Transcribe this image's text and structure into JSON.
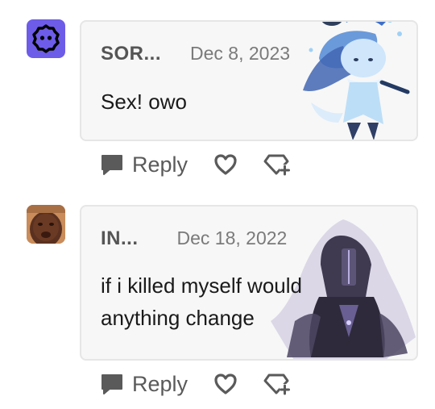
{
  "comments": [
    {
      "username": "SOR...",
      "date": "Dec 8, 2023",
      "text": "Sex! owo",
      "avatar_icon": "hexagon-face-icon",
      "avatar_color": "#6d5ce8",
      "decoration": "blue-ice-character-sticker",
      "reply_label": "Reply"
    },
    {
      "username": "IN...",
      "date": "Dec 18, 2022",
      "text_lines": [
        "if i killed myself would",
        "anything change"
      ],
      "avatar_icon": "person-photo-avatar",
      "decoration": "dark-knight-character-sticker",
      "reply_label": "Reply"
    }
  ],
  "colors": {
    "bubble_bg": "#f7f7f7",
    "bubble_border": "#e6e6e6",
    "icon_gray": "#5a5a5a"
  }
}
